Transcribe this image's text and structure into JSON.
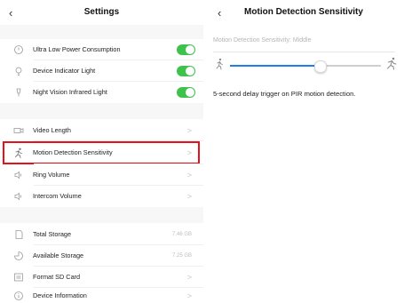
{
  "left": {
    "title": "Settings",
    "back_icon": "‹",
    "rows": [
      {
        "label": "Ultra Low Power Consumption",
        "icon": "power-icon",
        "type": "toggle",
        "on": true
      },
      {
        "label": "Device Indicator Light",
        "icon": "bulb-icon",
        "type": "toggle",
        "on": true
      },
      {
        "label": "Night Vision Infrared Light",
        "icon": "night-vision-icon",
        "type": "toggle",
        "on": true
      },
      {
        "label": "Video Length",
        "icon": "video-icon",
        "type": "chevron"
      },
      {
        "label": "Motion Detection Sensitivity",
        "icon": "running-person-icon",
        "type": "chevron"
      },
      {
        "label": "Ring Volume",
        "icon": "speaker-icon",
        "type": "chevron"
      },
      {
        "label": "Intercom Volume",
        "icon": "speaker-icon",
        "type": "chevron"
      },
      {
        "label": "Total Storage",
        "icon": "sd-card-icon",
        "type": "value",
        "value": "7.46 GB"
      },
      {
        "label": "Available Storage",
        "icon": "pie-icon",
        "type": "value",
        "value": "7.25 GB"
      },
      {
        "label": "Format SD Card",
        "icon": "format-icon",
        "type": "chevron"
      },
      {
        "label": "Device Information",
        "icon": "info-icon",
        "type": "chevron"
      }
    ]
  },
  "right": {
    "title": "Motion Detection Sensitivity",
    "back_icon": "‹",
    "sensitivity_label": "Motion Detection Sensitivity: Middle",
    "slider_value": 0.6,
    "note": "5-second delay trigger on PIR motion detection."
  },
  "colors": {
    "toggle_on": "#3dc24b",
    "highlight": "#e3121b",
    "slider_active": "#1e7fe6"
  }
}
